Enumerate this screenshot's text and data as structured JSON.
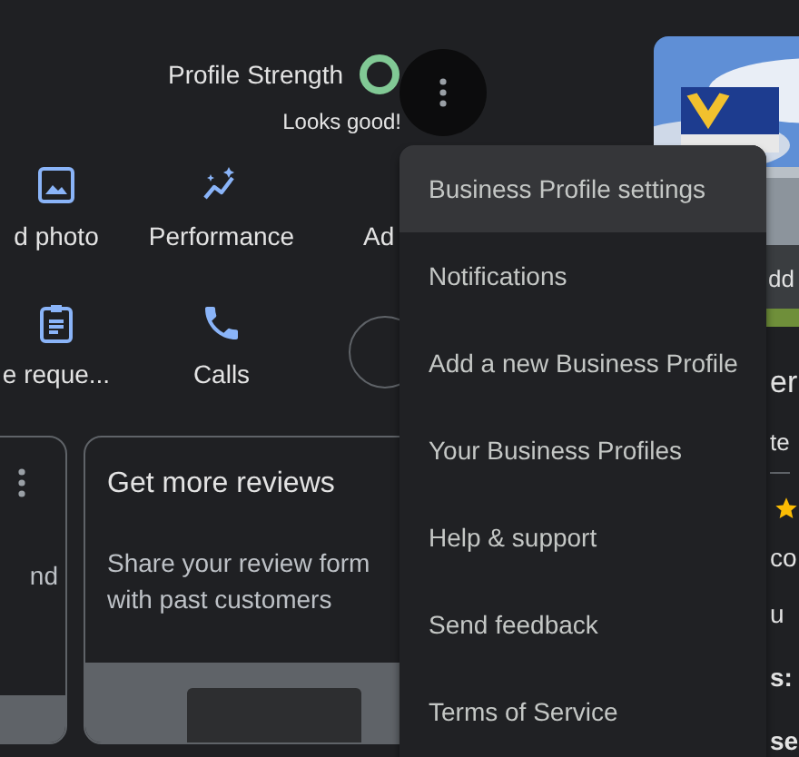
{
  "profile_strength": {
    "label": "Profile Strength",
    "status": "Looks good!"
  },
  "actions": [
    {
      "label": "d photo"
    },
    {
      "kind": "performance",
      "label": "Performance"
    },
    {
      "kind": "advert",
      "label": "Ad"
    },
    {
      "kind": "requests",
      "label": "e reque..."
    },
    {
      "kind": "calls",
      "label": "Calls"
    },
    {
      "kind": "round"
    }
  ],
  "cards": [
    {
      "text": "nd",
      "has_menu": true
    },
    {
      "title": "Get more reviews",
      "text": "Share your review form with past customers",
      "has_menu": false
    }
  ],
  "side_panel": {
    "photo_button": "dd",
    "items": [
      {
        "kind": "heading",
        "text": "er"
      },
      {
        "kind": "tab",
        "text": "te"
      },
      {
        "kind": "rating"
      },
      {
        "kind": "text",
        "text": "co"
      },
      {
        "kind": "text",
        "text": "u"
      },
      {
        "kind": "bold",
        "text": "s:"
      },
      {
        "kind": "bold",
        "text": "se"
      }
    ]
  },
  "menu": {
    "items": [
      {
        "label": "Business Profile settings",
        "highlighted": true
      },
      {
        "label": "Notifications",
        "highlighted": false
      },
      {
        "label": "Add a new Business Profile",
        "highlighted": false
      },
      {
        "label": "Your Business Profiles",
        "highlighted": false
      },
      {
        "label": "Help & support",
        "highlighted": false
      },
      {
        "label": "Send feedback",
        "highlighted": false
      },
      {
        "label": "Terms of Service",
        "highlighted": false
      }
    ]
  }
}
